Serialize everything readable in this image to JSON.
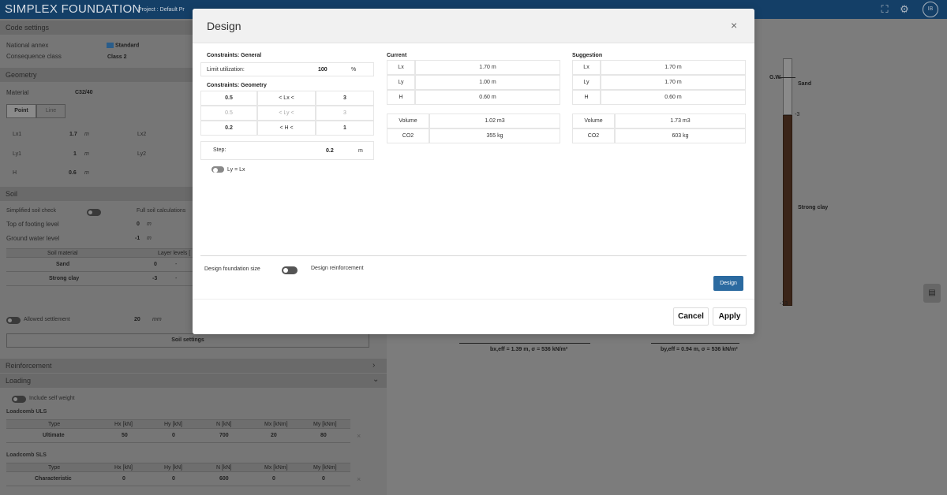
{
  "app": {
    "title": "SIMPLEX FOUNDATION",
    "project_label": "Project :",
    "project_name": "Default Pr",
    "avatar": "IB"
  },
  "left_panel": {
    "code_settings": {
      "header": "Code settings",
      "national_annex_label": "National annex",
      "national_annex_value": "Standard",
      "consequence_class_label": "Consequence class",
      "consequence_class_value": "Class 2"
    },
    "geometry": {
      "header": "Geometry",
      "material_label": "Material",
      "material_value": "C32/40",
      "tabs": [
        "Point",
        "Line"
      ],
      "rows": [
        {
          "label": "Lx1",
          "value": "1.7",
          "unit": "m",
          "label2": "Lx2"
        },
        {
          "label": "Ly1",
          "value": "1",
          "unit": "m",
          "label2": "Ly2"
        },
        {
          "label": "H",
          "value": "0.6",
          "unit": "m",
          "label2": ""
        }
      ]
    },
    "soil": {
      "header": "Soil",
      "simplified_label": "Simplified soil check",
      "full_label": "Full soil calculations",
      "top_footing_label": "Top of footing level",
      "top_footing_value": "0",
      "top_footing_unit": "m",
      "gwl_label": "Ground water level",
      "gwl_value": "-1",
      "gwl_unit": "m",
      "table_headers": [
        "Soil material",
        "Layer levels ["
      ],
      "table_rows": [
        {
          "material": "Sand",
          "level": "0",
          "dash": "-"
        },
        {
          "material": "Strong clay",
          "level": "-3",
          "dash": "-"
        }
      ],
      "settlement_label": "Allowed settlement",
      "settlement_value": "20",
      "settlement_unit": "mm",
      "settings_button": "Soil settings"
    },
    "reinforcement": {
      "header": "Reinforcement"
    },
    "loading": {
      "header": "Loading",
      "self_weight_label": "Include self weight",
      "uls_title": "Loadcomb ULS",
      "sls_title": "Loadcomb SLS",
      "headers": [
        "Type",
        "Hx [kN]",
        "Hy [kN]",
        "N [kN]",
        "Mx [kNm]",
        "My [kNm]"
      ],
      "uls_row": [
        "Ultimate",
        "50",
        "0",
        "700",
        "20",
        "80"
      ],
      "sls_row": [
        "Characteristic",
        "0",
        "0",
        "600",
        "0",
        "0"
      ],
      "delete_icon": "×"
    }
  },
  "canvas": {
    "gw_label": "G.W.",
    "sand_label": "Sand",
    "clay_label": "Strong clay",
    "level_m3": "-3",
    "level_m13": "-13",
    "dim_x": "bx,eff = 1.39 m, σ = 536 kN/m²",
    "dim_y": "by,eff = 0.94 m, σ = 536 kN/m²"
  },
  "modal": {
    "title": "Design",
    "close_icon": "×",
    "constraints_general": "Constraints:  General",
    "limit_label": "Limit utilization:",
    "limit_value": "100",
    "limit_unit": "%",
    "constraints_geometry": "Constraints:  Geometry",
    "geometry_rows": [
      {
        "min": "0.5",
        "op": "<  Lx  <",
        "max": "3"
      },
      {
        "min": "0.5",
        "op": "<  Ly  <",
        "max": "3"
      },
      {
        "min": "0.2",
        "op": "<  H  <",
        "max": "1"
      }
    ],
    "step_label": "Step:",
    "step_value": "0.2",
    "step_unit": "m",
    "lylx_label": "Ly = Lx",
    "current": {
      "title": "Current",
      "rows": [
        {
          "label": "Lx",
          "value": "1.70 m"
        },
        {
          "label": "Ly",
          "value": "1.00 m"
        },
        {
          "label": "H",
          "value": "0.60 m"
        }
      ],
      "volume_label": "Volume",
      "volume_value": "1.02 m3",
      "co2_label": "CO2",
      "co2_value": "355 kg"
    },
    "suggestion": {
      "title": "Suggestion",
      "rows": [
        {
          "label": "Lx",
          "value": "1.70 m"
        },
        {
          "label": "Ly",
          "value": "1.70 m"
        },
        {
          "label": "H",
          "value": "0.60 m"
        }
      ],
      "volume_label": "Volume",
      "volume_value": "1.73 m3",
      "co2_label": "CO2",
      "co2_value": "603 kg"
    },
    "design_size_label": "Design foundation size",
    "design_reinf_label": "Design reinforcement",
    "design_button": "Design",
    "cancel_button": "Cancel",
    "apply_button": "Apply"
  }
}
